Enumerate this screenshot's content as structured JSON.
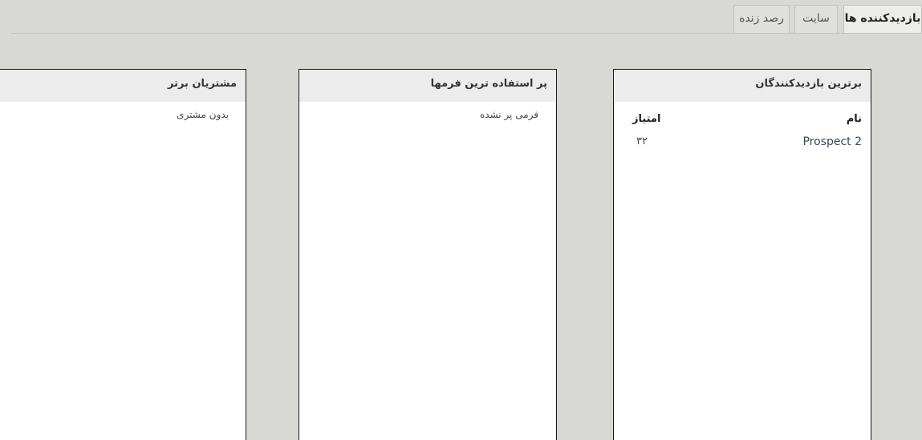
{
  "tabs": [
    {
      "label": "بازدیدکننده ها",
      "active": true
    },
    {
      "label": "سایت",
      "active": false
    },
    {
      "label": "رصد زنده",
      "active": false
    }
  ],
  "panels": {
    "top_visitors": {
      "title": "برترین بازدیدکنندگان",
      "columns": {
        "name": "نام",
        "score": "امتیاز"
      },
      "rows": [
        {
          "name": "Prospect 2",
          "score": "۳۲"
        }
      ]
    },
    "top_forms": {
      "title": "پر استفاده ترین فرمها",
      "empty": "فرمی پر نشده"
    },
    "top_customers": {
      "title": "مشتریان برتر",
      "empty": "بدون مشتری"
    }
  },
  "colors": {
    "background": "#d8d8d4",
    "panel_header": "#ececec",
    "panel_border": "#1a1a1a",
    "link": "#2f4a5a"
  }
}
